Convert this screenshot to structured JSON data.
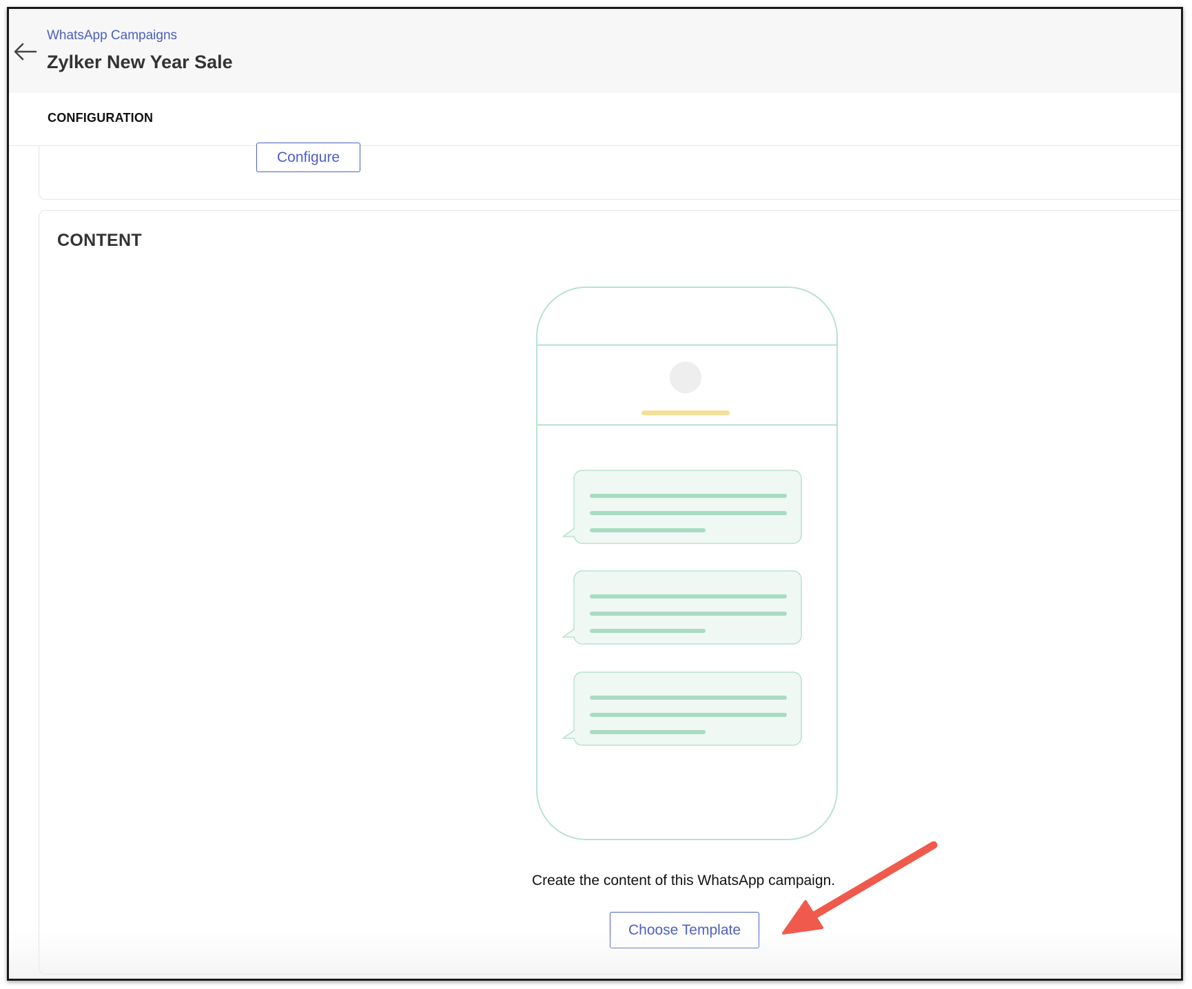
{
  "header": {
    "breadcrumb": "WhatsApp Campaigns",
    "title": "Zylker New Year Sale",
    "back_icon": "arrow-left-icon"
  },
  "configuration": {
    "section_label": "CONFIGURATION",
    "configure_label": "Configure"
  },
  "content": {
    "section_label": "CONTENT",
    "caption": "Create the content of this WhatsApp campaign.",
    "choose_template_label": "Choose Template",
    "illustration_icon": "phone-chat-illustration",
    "annotation_icon": "red-arrow-annotation"
  },
  "colors": {
    "accent": "#4a5fc1",
    "illustration_outline": "#b6e3cf",
    "bubble_fill": "#f0f8f4",
    "bubble_line": "#a8dcc1",
    "name_bar": "#f5df96",
    "annotation_arrow": "#ef5a4c"
  }
}
